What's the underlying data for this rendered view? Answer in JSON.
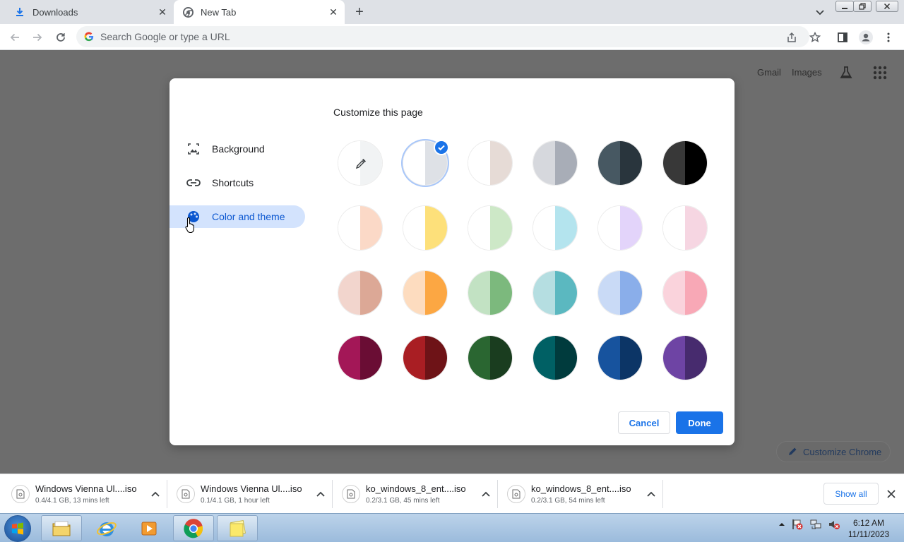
{
  "browser": {
    "tabs": [
      {
        "label": "Downloads",
        "icon": "download-icon",
        "active": false
      },
      {
        "label": "New Tab",
        "icon": "chrome-icon",
        "active": true
      }
    ],
    "omnibox_placeholder": "Search Google or type a URL"
  },
  "page": {
    "links": {
      "gmail": "Gmail",
      "images": "Images"
    },
    "customize_chrome_label": "Customize Chrome"
  },
  "dialog": {
    "title": "Customize this page",
    "nav": [
      {
        "label": "Background",
        "icon": "image-icon",
        "selected": false
      },
      {
        "label": "Shortcuts",
        "icon": "link-icon",
        "selected": false
      },
      {
        "label": "Color and theme",
        "icon": "palette-icon",
        "selected": true
      }
    ],
    "colors": [
      {
        "left": "#ffffff",
        "right": "#f1f3f4",
        "type": "custom"
      },
      {
        "left": "#ffffff",
        "right": "#dee1e6",
        "selected": true
      },
      {
        "left": "#ffffff",
        "right": "#e6dbd6"
      },
      {
        "left": "#d6d8dd",
        "right": "#a8adb7"
      },
      {
        "left": "#475862",
        "right": "#29353d"
      },
      {
        "left": "#383838",
        "right": "#000000"
      },
      {
        "left": "#ffffff",
        "right": "#fbd9c7"
      },
      {
        "left": "#ffffff",
        "right": "#fde07a"
      },
      {
        "left": "#ffffff",
        "right": "#cde8c7"
      },
      {
        "left": "#ffffff",
        "right": "#b4e4ee"
      },
      {
        "left": "#ffffff",
        "right": "#e3d4fa"
      },
      {
        "left": "#ffffff",
        "right": "#f6d6e2"
      },
      {
        "left": "#f2d5cd",
        "right": "#dca896"
      },
      {
        "left": "#fddcbf",
        "right": "#fca743"
      },
      {
        "left": "#c2e2c3",
        "right": "#7cb97d"
      },
      {
        "left": "#b5dee1",
        "right": "#5bb8c0"
      },
      {
        "left": "#c9daf6",
        "right": "#8aaeea"
      },
      {
        "left": "#fad3dc",
        "right": "#f8a8b6"
      },
      {
        "left": "#a31757",
        "right": "#6a0d34"
      },
      {
        "left": "#a91e23",
        "right": "#6e1317"
      },
      {
        "left": "#2a6631",
        "right": "#1a3d1f"
      },
      {
        "left": "#006064",
        "right": "#003b3d"
      },
      {
        "left": "#17539e",
        "right": "#0c3566"
      },
      {
        "left": "#6e44a4",
        "right": "#472b6e"
      }
    ],
    "cancel_label": "Cancel",
    "done_label": "Done"
  },
  "downloads": {
    "items": [
      {
        "name": "Windows Vienna Ul....iso",
        "status": "0.4/4.1 GB, 13 mins left"
      },
      {
        "name": "Windows Vienna Ul....iso",
        "status": "0.1/4.1 GB, 1 hour left"
      },
      {
        "name": "ko_windows_8_ent....iso",
        "status": "0.2/3.1 GB, 45 mins left"
      },
      {
        "name": "ko_windows_8_ent....iso",
        "status": "0.2/3.1 GB, 54 mins left"
      }
    ],
    "show_all_label": "Show all"
  },
  "taskbar": {
    "apps": [
      "file-explorer-icon",
      "internet-explorer-icon",
      "media-player-icon",
      "chrome-icon",
      "sticky-notes-icon"
    ],
    "clock_time": "6:12 AM",
    "clock_date": "11/11/2023"
  }
}
